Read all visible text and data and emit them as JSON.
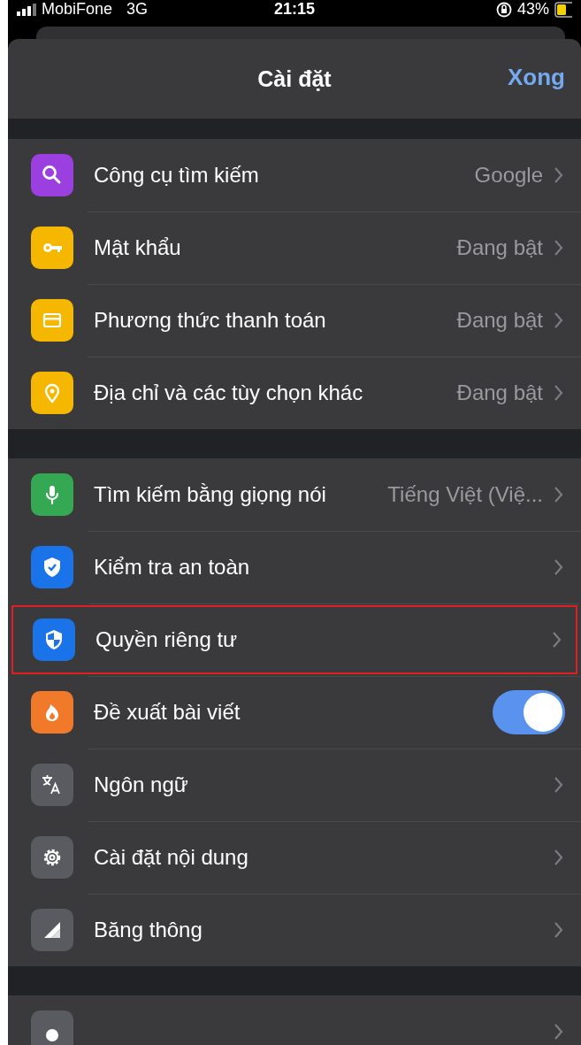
{
  "status_bar": {
    "carrier": "MobiFone",
    "network": "3G",
    "time": "21:15",
    "battery": "43%"
  },
  "header": {
    "title": "Cài đặt",
    "done": "Xong"
  },
  "groups": [
    {
      "rows": [
        {
          "kind": "link",
          "label": "Công cụ tìm kiếm",
          "value": "Google",
          "highlighted": false
        },
        {
          "kind": "link",
          "label": "Mật khẩu",
          "value": "Đang bật",
          "highlighted": false
        },
        {
          "kind": "link",
          "label": "Phương thức thanh toán",
          "value": "Đang bật",
          "highlighted": false
        },
        {
          "kind": "link",
          "label": "Địa chỉ và các tùy chọn khác",
          "value": "Đang bật",
          "highlighted": false
        }
      ]
    },
    {
      "rows": [
        {
          "kind": "link",
          "label": "Tìm kiếm bằng giọng nói",
          "value": "Tiếng Việt (Việ...",
          "highlighted": false
        },
        {
          "kind": "link",
          "label": "Kiểm tra an toàn",
          "highlighted": false
        },
        {
          "kind": "link",
          "label": "Quyền riêng tư",
          "highlighted": true
        },
        {
          "kind": "toggle",
          "label": "Đề xuất bài viết",
          "on": true,
          "highlighted": false
        },
        {
          "kind": "link",
          "label": "Ngôn ngữ",
          "highlighted": false
        },
        {
          "kind": "link",
          "label": "Cài đặt nội dung",
          "highlighted": false
        },
        {
          "kind": "link",
          "label": "Băng thông",
          "highlighted": false
        }
      ]
    },
    {
      "rows": [
        {
          "kind": "link",
          "highlighted": false
        }
      ]
    }
  ]
}
